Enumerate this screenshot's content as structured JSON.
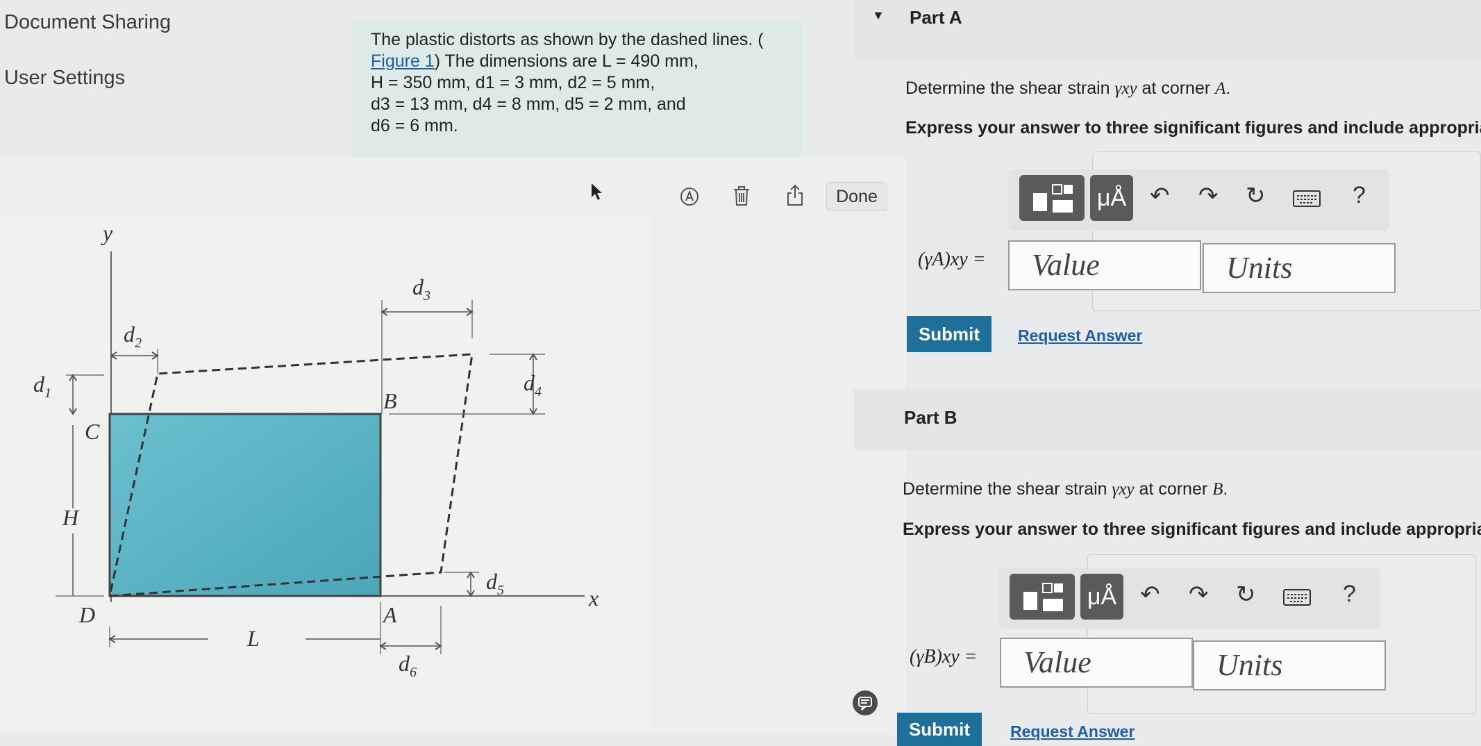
{
  "nav": {
    "items": [
      "Document Sharing",
      "User Settings"
    ]
  },
  "problem": {
    "line1": "The plastic distorts as shown by the dashed lines. (",
    "figure_link": "Figure 1",
    "line2_rest": ") The dimensions are L = 490 mm,",
    "line3": "H = 350 mm, d1 = 3 mm, d2 = 5 mm,",
    "line4": "d3 = 13 mm, d4 = 8 mm, d5 = 2 mm, and",
    "line5": "d6 = 6 mm."
  },
  "viewer": {
    "done_label": "Done"
  },
  "figure": {
    "labels": {
      "y": "y",
      "x": "x",
      "d1": "d",
      "d2": "d",
      "d3": "d",
      "d4": "d",
      "d5": "d",
      "d6": "d",
      "d1_sub": "1",
      "d2_sub": "2",
      "d3_sub": "3",
      "d4_sub": "4",
      "d5_sub": "5",
      "d6_sub": "6",
      "B": "B",
      "C": "C",
      "H": "H",
      "D": "D",
      "A": "A",
      "L": "L"
    },
    "colors": {
      "plate": "#5fb6c6",
      "line": "#333333"
    }
  },
  "partA": {
    "title": "Part A",
    "question_pre": "Determine the shear strain ",
    "question_sym": "γxy",
    "question_post": " at corner ",
    "question_corner": "A",
    "question_end": ".",
    "instruction": "Express your answer to three significant figures and include appropria",
    "answer_label": "(γA)xy =",
    "value_placeholder": "Value",
    "units_placeholder": "Units",
    "submit_label": "Submit",
    "request_label": "Request Answer"
  },
  "partB": {
    "title": "Part B",
    "question_pre": "Determine the shear strain ",
    "question_sym": "γxy",
    "question_post": " at corner ",
    "question_corner": "B",
    "question_end": ".",
    "instruction": "Express your answer to three significant figures and include appropriat",
    "answer_label": "(γB)xy =",
    "value_placeholder": "Value",
    "units_placeholder": "Units",
    "submit_label": "Submit",
    "request_label": "Request Answer"
  },
  "toolbar": {
    "units_symbol": "μÅ",
    "help_symbol": "?"
  }
}
